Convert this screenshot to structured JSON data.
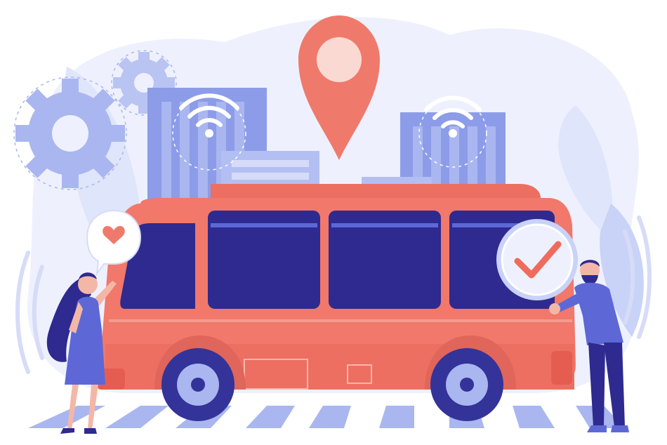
{
  "illustration": {
    "icons": {
      "location_pin": "location-pin-icon",
      "wifi": "wifi-icon",
      "gear": "gear-icon",
      "heart": "heart-icon",
      "checkmark": "checkmark-icon"
    },
    "colors": {
      "bus": "#f1786a",
      "bus_dark": "#e0655a",
      "windows": "#2e2a8f",
      "wheel": "#333399",
      "light_blue": "#d6dcf8",
      "mid_blue": "#a9b6f0",
      "accent_blue": "#5d68d6",
      "pin": "#ef7a6c",
      "check": "#ef6b5c"
    }
  }
}
